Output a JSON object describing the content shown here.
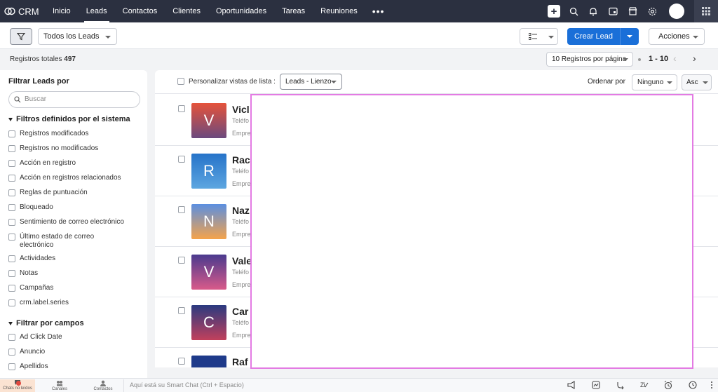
{
  "app": {
    "name": "CRM"
  },
  "nav": {
    "items": [
      {
        "label": "Inicio",
        "active": false
      },
      {
        "label": "Leads",
        "active": true
      },
      {
        "label": "Contactos",
        "active": false
      },
      {
        "label": "Clientes",
        "active": false
      },
      {
        "label": "Oportunidades",
        "active": false
      },
      {
        "label": "Tareas",
        "active": false
      },
      {
        "label": "Reuniones",
        "active": false
      }
    ],
    "more": "•••"
  },
  "toolbar": {
    "view_selector": "Todos los Leads",
    "create_button": "Crear Lead",
    "actions_button": "Acciones"
  },
  "records": {
    "total_label": "Registros totales",
    "total_count": "497",
    "per_page": "10 Registros por página",
    "range": "1 - 10"
  },
  "sidebar": {
    "title": "Filtrar Leads por",
    "search_placeholder": "Buscar",
    "system_section": "Filtros definidos por el sistema",
    "system_filters": [
      "Registros modificados",
      "Registros no modificados",
      "Acción en registro",
      "Acción en registros relacionados",
      "Reglas de puntuación",
      "Bloqueado",
      "Sentimiento de correo electrónico",
      "Último estado de correo electrónico",
      "Actividades",
      "Notas",
      "Campañas",
      "crm.label.series"
    ],
    "field_section": "Filtrar por campos",
    "field_filters": [
      "Ad Click Date",
      "Anuncio",
      "Apellidos"
    ]
  },
  "list": {
    "customize_label": "Personalizar vistas de lista :",
    "view_mode": "Leads - Lienzo",
    "sort_label": "Ordenar por",
    "sort_field": "Ninguno",
    "sort_order": "Asc",
    "rows": [
      {
        "initial": "V",
        "name": "Vicl",
        "phone": "Teléfo",
        "company": "Empre",
        "grad_top": "#e5533b",
        "grad_bottom": "#6b4a7e"
      },
      {
        "initial": "R",
        "name": "Rac",
        "phone": "Teléfo",
        "company": "Empre",
        "grad_top": "#2673c9",
        "grad_bottom": "#5da6e0"
      },
      {
        "initial": "N",
        "name": "Naz",
        "phone": "Teléfo",
        "company": "Empre",
        "grad_top": "#5b8fe0",
        "grad_bottom": "#f5a34a"
      },
      {
        "initial": "V",
        "name": "Vale",
        "phone": "Teléfo",
        "company": "Empre",
        "grad_top": "#4a3a8e",
        "grad_bottom": "#d95a8a"
      },
      {
        "initial": "C",
        "name": "Car",
        "phone": "Teléfo",
        "company": "Empre",
        "grad_top": "#2a3a80",
        "grad_bottom": "#c2405c"
      },
      {
        "initial": "",
        "name": "Raf",
        "phone": "",
        "company": "",
        "grad_top": "#1e3a8a",
        "grad_bottom": "#1e3a8a"
      }
    ]
  },
  "bottom_bar": {
    "chats": "Chats no leídos",
    "channels": "Canales",
    "contacts": "Contactos",
    "smart_chat_placeholder": "Aquí está su Smart Chat (Ctrl + Espacio)"
  },
  "colors": {
    "topnav": "#2b3040",
    "primary": "#1a6fd8",
    "overlay_border": "#e37be3"
  }
}
